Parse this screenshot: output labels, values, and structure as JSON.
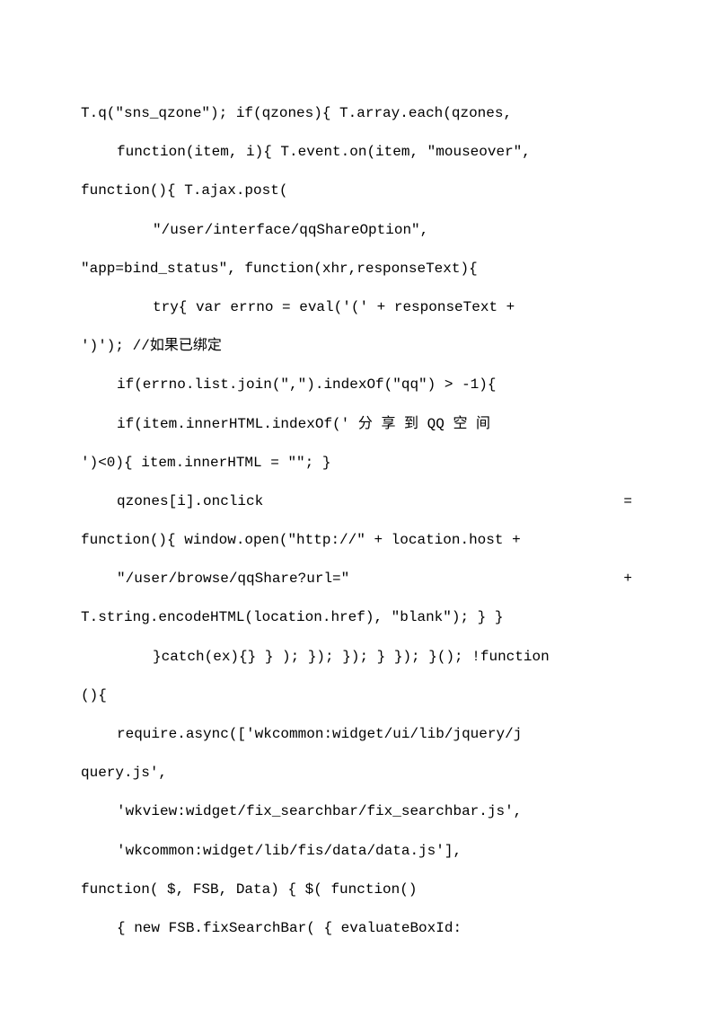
{
  "lines": [
    {
      "cls": "",
      "text": "T.q(\"sns_qzone\"); if(qzones){ T.array.each(qzones,"
    },
    {
      "cls": "indent1",
      "text": "function(item, i){ T.event.on(item, \"mouseover\","
    },
    {
      "cls": "",
      "text": "function(){ T.ajax.post("
    },
    {
      "cls": "indent2",
      "text": "\"/user/interface/qqShareOption\","
    },
    {
      "cls": "",
      "text": "\"app=bind_status\", function(xhr,responseText){"
    },
    {
      "cls": "indent2 justify",
      "parts": [
        "try{  var  errno  =  eval('('  +  responseText  +",
        ""
      ]
    },
    {
      "cls": "",
      "text": "')'); //如果已绑定"
    },
    {
      "cls": "indent1",
      "text": "if(errno.list.join(\",\").indexOf(\"qq\") > -1){"
    },
    {
      "cls": "indent1 justify",
      "parts": [
        "if(item.innerHTML.indexOf(' 分  享  到  QQ  空  间",
        ""
      ]
    },
    {
      "cls": "",
      "text": "')<0){ item.innerHTML = \"\"; }"
    },
    {
      "cls": "indent1 justify",
      "parts": [
        "qzones[i].onclick",
        "="
      ]
    },
    {
      "cls": "",
      "text": "function(){ window.open(\"http://\" + location.host +"
    },
    {
      "cls": "indent1 justify",
      "parts": [
        "\"/user/browse/qqShare?url=\"",
        "+"
      ]
    },
    {
      "cls": "",
      "text": "T.string.encodeHTML(location.href), \"blank\"); } }"
    },
    {
      "cls": "indent2",
      "text": "}catch(ex){} } ); }); }); } }); }(); !function"
    },
    {
      "cls": "",
      "text": "(){"
    },
    {
      "cls": "indent1",
      "text": "require.async(['wkcommon:widget/ui/lib/jquery/j"
    },
    {
      "cls": "",
      "text": "query.js',"
    },
    {
      "cls": "indent1",
      "text": "'wkview:widget/fix_searchbar/fix_searchbar.js',"
    },
    {
      "cls": "indent1",
      "text": "'wkcommon:widget/lib/fis/data/data.js'],"
    },
    {
      "cls": "",
      "text": "function( $, FSB, Data) { $( function()"
    },
    {
      "cls": "indent1 justify",
      "parts": [
        "{   new   FSB.fixSearchBar(   {   evaluateBoxId:",
        ""
      ]
    }
  ]
}
